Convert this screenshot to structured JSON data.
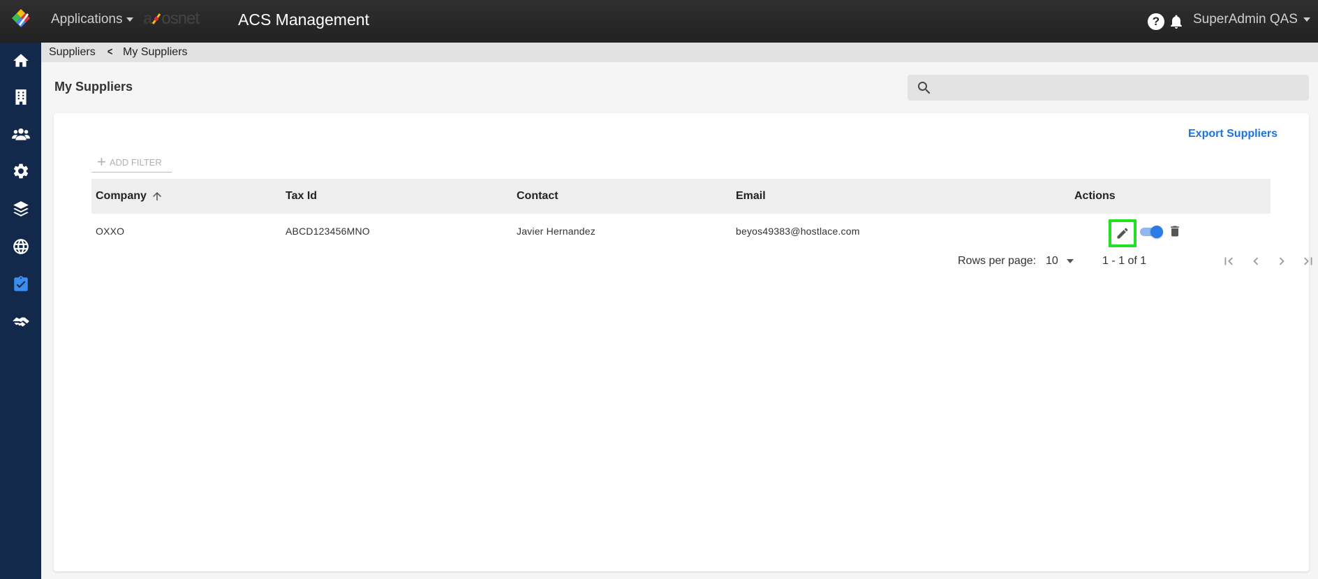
{
  "topbar": {
    "applications_label": "Applications",
    "brand_text_a": "a",
    "brand_text_b": "osnet",
    "app_title": "ACS Management",
    "help_label": "?",
    "user_name": "SuperAdmin QAS"
  },
  "sidenav": {
    "items": [
      {
        "name": "home-icon"
      },
      {
        "name": "building-icon"
      },
      {
        "name": "users-icon"
      },
      {
        "name": "gear-icon"
      },
      {
        "name": "layers-icon"
      },
      {
        "name": "globe-icon"
      },
      {
        "name": "clipboard-check-icon",
        "active": true
      },
      {
        "name": "handshake-icon"
      }
    ],
    "active_color": "#3b8ef0",
    "background": "#13294b"
  },
  "breadcrumb": {
    "items": [
      "Suppliers",
      "My Suppliers"
    ],
    "separator": "<"
  },
  "page": {
    "title": "My Suppliers",
    "search_placeholder": ""
  },
  "card": {
    "export_label": "Export Suppliers",
    "add_filter_label": "ADD FILTER",
    "columns": [
      "Company",
      "Tax Id",
      "Contact",
      "Email",
      "Actions"
    ],
    "sorted_column": "Company",
    "sort_direction": "ascending",
    "rows": [
      {
        "company": "OXXO",
        "tax_id": "ABCD123456MNO",
        "contact": "Javier Hernandez",
        "email": "beyos49383@hostlace.com",
        "active": true
      }
    ],
    "pagination": {
      "rows_per_page_label": "Rows per page:",
      "rows_per_page_value": "10",
      "range": "1 - 1 of 1"
    }
  },
  "colors": {
    "accent": "#1e73d8",
    "highlight_box": "#22e022"
  }
}
